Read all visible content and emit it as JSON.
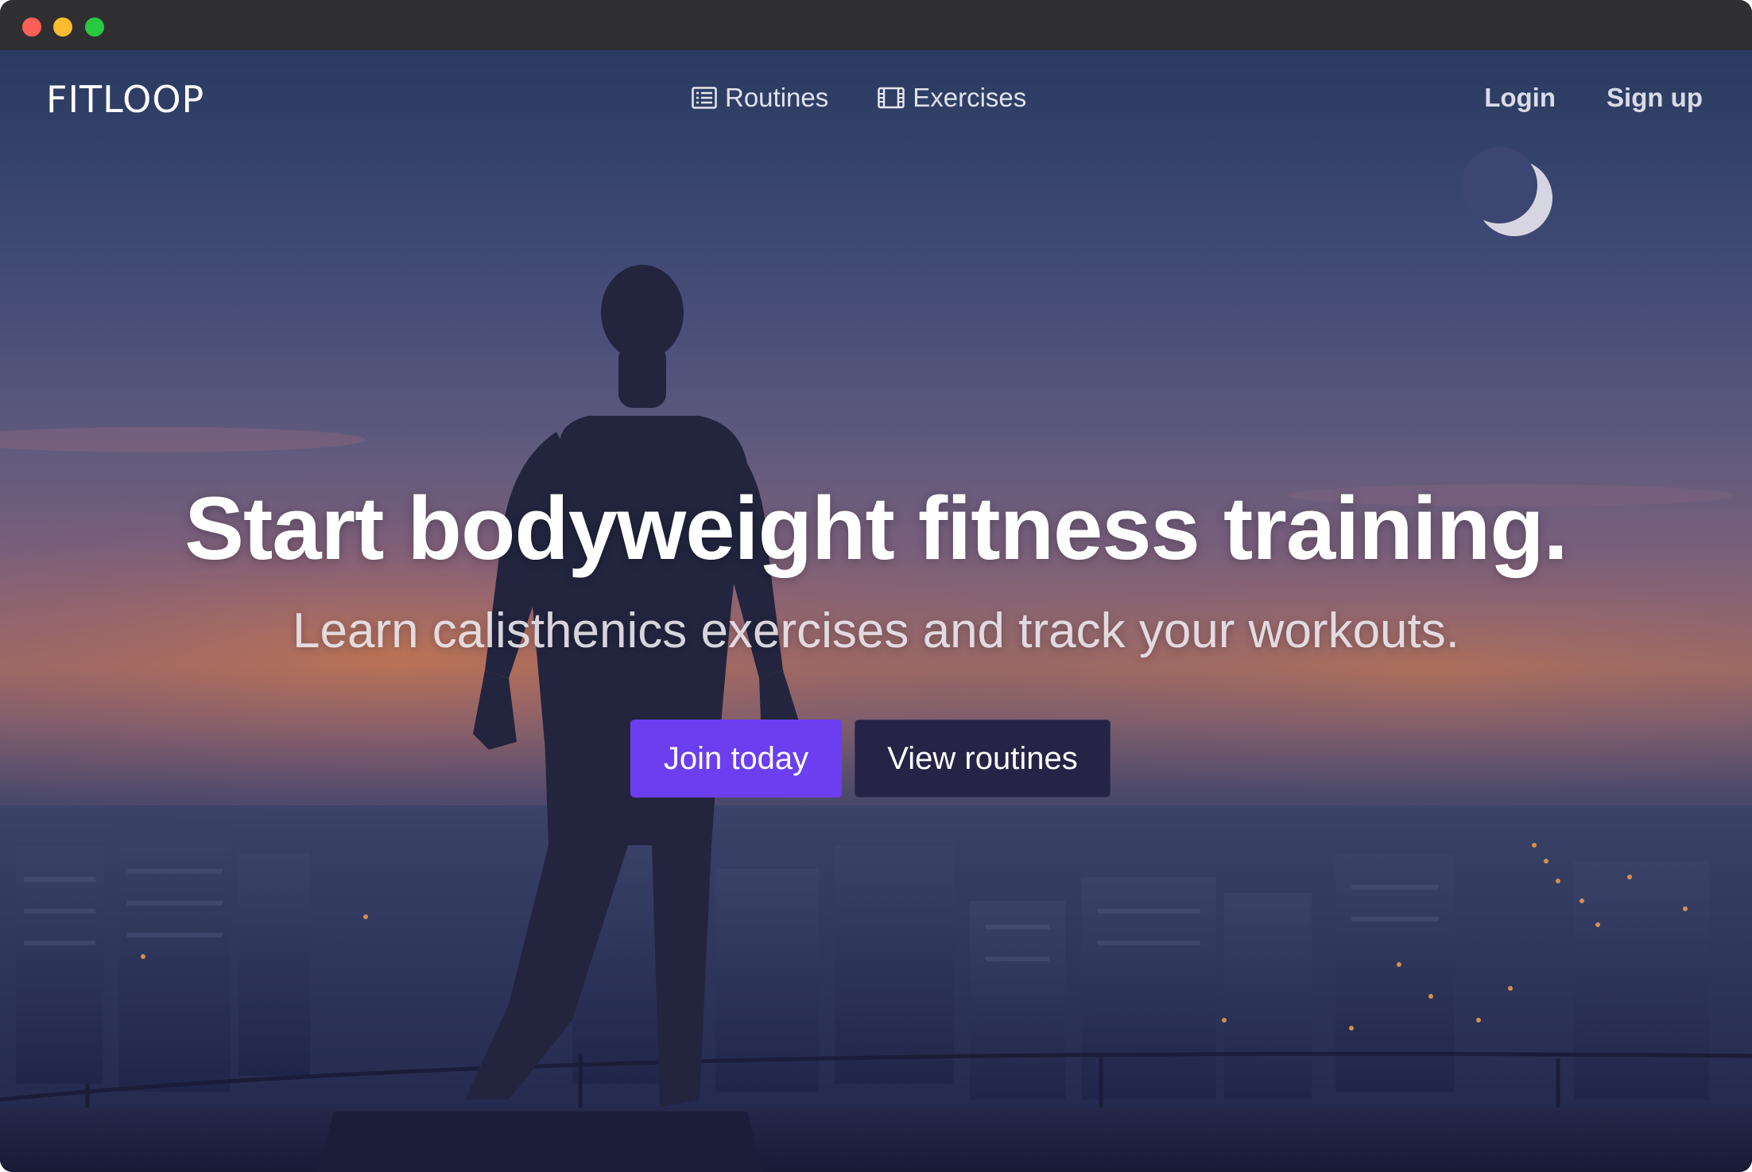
{
  "brand": {
    "name": "FITLOOP"
  },
  "nav": {
    "links": [
      {
        "label": "Routines",
        "icon": "list-icon"
      },
      {
        "label": "Exercises",
        "icon": "film-icon"
      }
    ],
    "auth": {
      "login_label": "Login",
      "signup_label": "Sign up"
    }
  },
  "hero": {
    "headline": "Start bodyweight fitness training.",
    "subheadline": "Learn calisthenics exercises and track your workouts.",
    "primary_cta": "Join today",
    "secondary_cta": "View routines"
  },
  "colors": {
    "primary_button": "#6b3ff0",
    "secondary_button": "#262446",
    "titlebar": "#2f2f31"
  }
}
